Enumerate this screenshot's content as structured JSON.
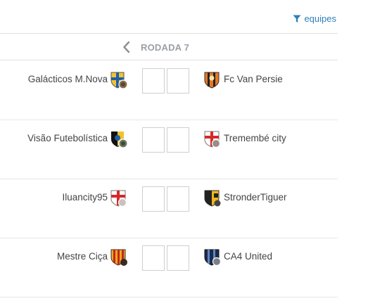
{
  "header": {
    "filter_label": "equipes",
    "filter_icon": "filter-icon"
  },
  "round": {
    "title": "RODADA 7",
    "prev_icon": "chevron-left-icon"
  },
  "colors": {
    "link": "#2f7fb9",
    "round_title": "#9aa0a6"
  },
  "matches": [
    {
      "home": "Galácticos M.Nova",
      "away": "Fc Van Persie",
      "home_score": "",
      "away_score": ""
    },
    {
      "home": "Visão Futebolística",
      "away": "Tremembé city",
      "home_score": "",
      "away_score": ""
    },
    {
      "home": "Iluancity95",
      "away": "StronderTiguer",
      "home_score": "",
      "away_score": ""
    },
    {
      "home": "Mestre Ciça",
      "away": "CA4 United",
      "home_score": "",
      "away_score": ""
    }
  ]
}
